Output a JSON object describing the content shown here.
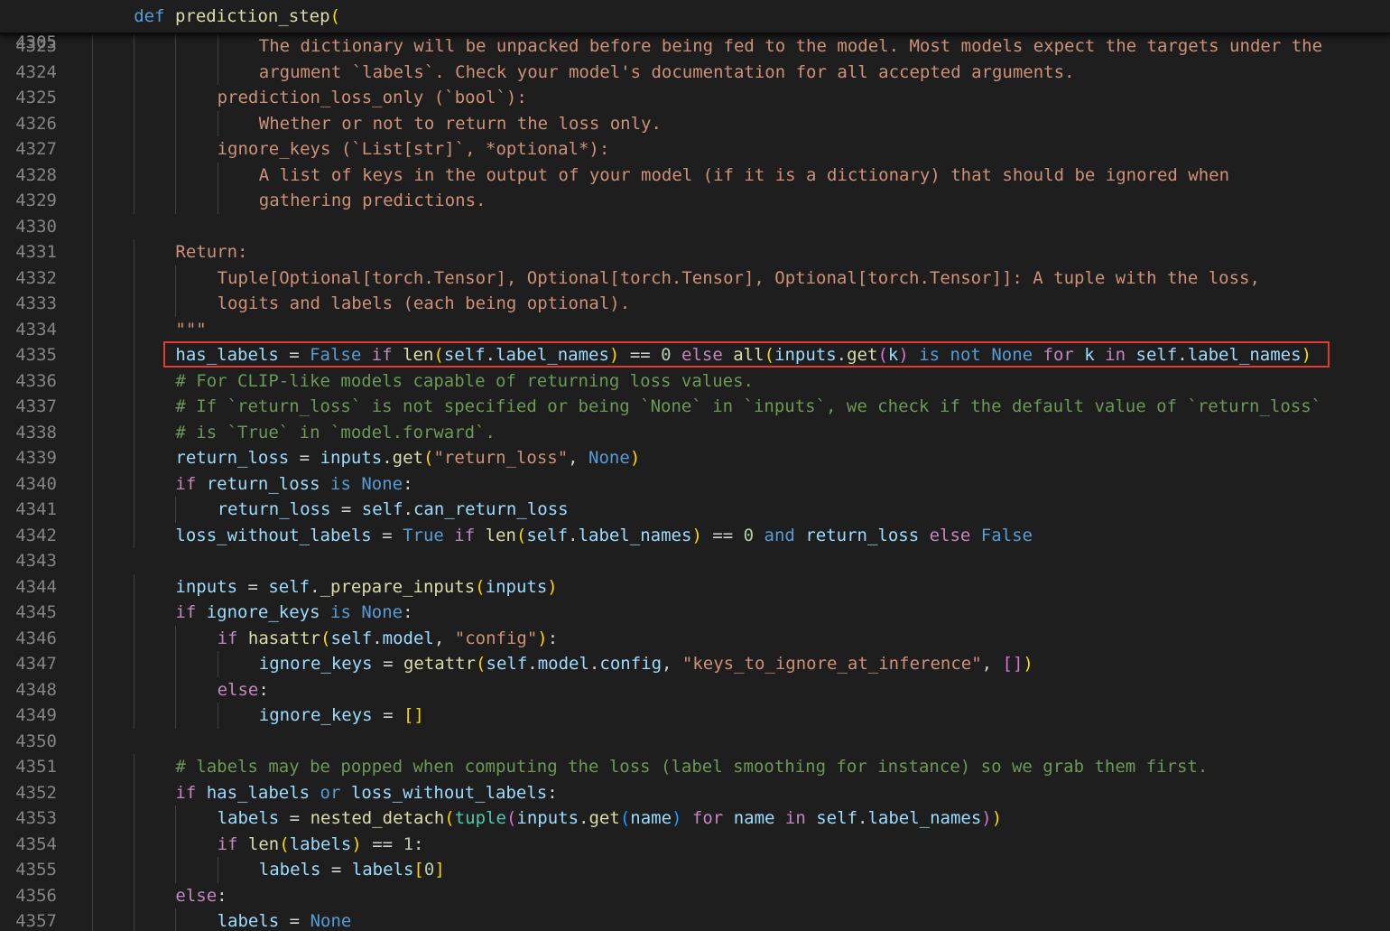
{
  "sticky": {
    "line_number": "4305",
    "tokens": [
      [
        "k",
        "def "
      ],
      [
        "f",
        "prediction_step"
      ],
      [
        "b1",
        "("
      ]
    ]
  },
  "lines": [
    {
      "n": "4323",
      "indent": 4,
      "tokens": [
        [
          "s",
          "The dictionary will be unpacked before being fed to the model. Most models expect the targets under the"
        ]
      ]
    },
    {
      "n": "4324",
      "indent": 4,
      "tokens": [
        [
          "s",
          "argument `labels`. Check your model's documentation for all accepted arguments."
        ]
      ]
    },
    {
      "n": "4325",
      "indent": 3,
      "tokens": [
        [
          "s",
          "prediction_loss_only (`bool`):"
        ]
      ]
    },
    {
      "n": "4326",
      "indent": 4,
      "tokens": [
        [
          "s",
          "Whether or not to return the loss only."
        ]
      ]
    },
    {
      "n": "4327",
      "indent": 3,
      "tokens": [
        [
          "s",
          "ignore_keys (`List[str]`, *optional*):"
        ]
      ]
    },
    {
      "n": "4328",
      "indent": 4,
      "tokens": [
        [
          "s",
          "A list of keys in the output of your model (if it is a dictionary) that should be ignored when"
        ]
      ]
    },
    {
      "n": "4329",
      "indent": 4,
      "tokens": [
        [
          "s",
          "gathering predictions."
        ]
      ]
    },
    {
      "n": "4330",
      "indent": 1,
      "tokens": []
    },
    {
      "n": "4331",
      "indent": 2,
      "tokens": [
        [
          "s",
          "Return:"
        ]
      ]
    },
    {
      "n": "4332",
      "indent": 3,
      "tokens": [
        [
          "s",
          "Tuple[Optional[torch.Tensor], Optional[torch.Tensor], Optional[torch.Tensor]]: A tuple with the loss,"
        ]
      ]
    },
    {
      "n": "4333",
      "indent": 3,
      "tokens": [
        [
          "s",
          "logits and labels (each being optional)."
        ]
      ]
    },
    {
      "n": "4334",
      "indent": 2,
      "tokens": [
        [
          "s",
          "\"\"\""
        ]
      ]
    },
    {
      "n": "4335",
      "indent": 2,
      "highlight": true,
      "tokens": [
        [
          "v",
          "has_labels"
        ],
        [
          "w",
          " = "
        ],
        [
          "k",
          "False"
        ],
        [
          "c",
          " if "
        ],
        [
          "f",
          "len"
        ],
        [
          "b1",
          "("
        ],
        [
          "v",
          "self"
        ],
        [
          "w",
          "."
        ],
        [
          "v",
          "label_names"
        ],
        [
          "b1",
          ")"
        ],
        [
          "w",
          " == "
        ],
        [
          "n",
          "0"
        ],
        [
          "c",
          " else "
        ],
        [
          "f",
          "all"
        ],
        [
          "b1",
          "("
        ],
        [
          "v",
          "inputs"
        ],
        [
          "w",
          "."
        ],
        [
          "f",
          "get"
        ],
        [
          "b2",
          "("
        ],
        [
          "v",
          "k"
        ],
        [
          "b2",
          ")"
        ],
        [
          "k",
          " is not "
        ],
        [
          "k",
          "None"
        ],
        [
          "c",
          " for "
        ],
        [
          "v",
          "k"
        ],
        [
          "c",
          " in "
        ],
        [
          "v",
          "self"
        ],
        [
          "w",
          "."
        ],
        [
          "v",
          "label_names"
        ],
        [
          "b1",
          ")"
        ]
      ]
    },
    {
      "n": "4336",
      "indent": 2,
      "tokens": [
        [
          "m",
          "# For CLIP-like models capable of returning loss values."
        ]
      ]
    },
    {
      "n": "4337",
      "indent": 2,
      "tokens": [
        [
          "m",
          "# If `return_loss` is not specified or being `None` in `inputs`, we check if the default value of `return_loss`"
        ]
      ]
    },
    {
      "n": "4338",
      "indent": 2,
      "tokens": [
        [
          "m",
          "# is `True` in `model.forward`."
        ]
      ]
    },
    {
      "n": "4339",
      "indent": 2,
      "tokens": [
        [
          "v",
          "return_loss"
        ],
        [
          "w",
          " = "
        ],
        [
          "v",
          "inputs"
        ],
        [
          "w",
          "."
        ],
        [
          "f",
          "get"
        ],
        [
          "b1",
          "("
        ],
        [
          "s",
          "\"return_loss\""
        ],
        [
          "w",
          ", "
        ],
        [
          "k",
          "None"
        ],
        [
          "b1",
          ")"
        ]
      ]
    },
    {
      "n": "4340",
      "indent": 2,
      "tokens": [
        [
          "c",
          "if "
        ],
        [
          "v",
          "return_loss"
        ],
        [
          "k",
          " is "
        ],
        [
          "k",
          "None"
        ],
        [
          "w",
          ":"
        ]
      ]
    },
    {
      "n": "4341",
      "indent": 3,
      "tokens": [
        [
          "v",
          "return_loss"
        ],
        [
          "w",
          " = "
        ],
        [
          "v",
          "self"
        ],
        [
          "w",
          "."
        ],
        [
          "v",
          "can_return_loss"
        ]
      ]
    },
    {
      "n": "4342",
      "indent": 2,
      "tokens": [
        [
          "v",
          "loss_without_labels"
        ],
        [
          "w",
          " = "
        ],
        [
          "k",
          "True"
        ],
        [
          "c",
          " if "
        ],
        [
          "f",
          "len"
        ],
        [
          "b1",
          "("
        ],
        [
          "v",
          "self"
        ],
        [
          "w",
          "."
        ],
        [
          "v",
          "label_names"
        ],
        [
          "b1",
          ")"
        ],
        [
          "w",
          " == "
        ],
        [
          "n",
          "0"
        ],
        [
          "k",
          " and "
        ],
        [
          "v",
          "return_loss"
        ],
        [
          "c",
          " else "
        ],
        [
          "k",
          "False"
        ]
      ]
    },
    {
      "n": "4343",
      "indent": 1,
      "tokens": []
    },
    {
      "n": "4344",
      "indent": 2,
      "tokens": [
        [
          "v",
          "inputs"
        ],
        [
          "w",
          " = "
        ],
        [
          "v",
          "self"
        ],
        [
          "w",
          "."
        ],
        [
          "f",
          "_prepare_inputs"
        ],
        [
          "b1",
          "("
        ],
        [
          "v",
          "inputs"
        ],
        [
          "b1",
          ")"
        ]
      ]
    },
    {
      "n": "4345",
      "indent": 2,
      "tokens": [
        [
          "c",
          "if "
        ],
        [
          "v",
          "ignore_keys"
        ],
        [
          "k",
          " is "
        ],
        [
          "k",
          "None"
        ],
        [
          "w",
          ":"
        ]
      ]
    },
    {
      "n": "4346",
      "indent": 3,
      "tokens": [
        [
          "c",
          "if "
        ],
        [
          "f",
          "hasattr"
        ],
        [
          "b1",
          "("
        ],
        [
          "v",
          "self"
        ],
        [
          "w",
          "."
        ],
        [
          "v",
          "model"
        ],
        [
          "w",
          ", "
        ],
        [
          "s",
          "\"config\""
        ],
        [
          "b1",
          ")"
        ],
        [
          "w",
          ":"
        ]
      ]
    },
    {
      "n": "4347",
      "indent": 4,
      "tokens": [
        [
          "v",
          "ignore_keys"
        ],
        [
          "w",
          " = "
        ],
        [
          "f",
          "getattr"
        ],
        [
          "b1",
          "("
        ],
        [
          "v",
          "self"
        ],
        [
          "w",
          "."
        ],
        [
          "v",
          "model"
        ],
        [
          "w",
          "."
        ],
        [
          "v",
          "config"
        ],
        [
          "w",
          ", "
        ],
        [
          "s",
          "\"keys_to_ignore_at_inference\""
        ],
        [
          "w",
          ", "
        ],
        [
          "b2",
          "[]"
        ],
        [
          "b1",
          ")"
        ]
      ]
    },
    {
      "n": "4348",
      "indent": 3,
      "tokens": [
        [
          "c",
          "else"
        ],
        [
          "w",
          ":"
        ]
      ]
    },
    {
      "n": "4349",
      "indent": 4,
      "tokens": [
        [
          "v",
          "ignore_keys"
        ],
        [
          "w",
          " = "
        ],
        [
          "b1",
          "[]"
        ]
      ]
    },
    {
      "n": "4350",
      "indent": 1,
      "tokens": []
    },
    {
      "n": "4351",
      "indent": 2,
      "tokens": [
        [
          "m",
          "# labels may be popped when computing the loss (label smoothing for instance) so we grab them first."
        ]
      ]
    },
    {
      "n": "4352",
      "indent": 2,
      "tokens": [
        [
          "c",
          "if "
        ],
        [
          "v",
          "has_labels"
        ],
        [
          "k",
          " or "
        ],
        [
          "v",
          "loss_without_labels"
        ],
        [
          "w",
          ":"
        ]
      ]
    },
    {
      "n": "4353",
      "indent": 3,
      "tokens": [
        [
          "v",
          "labels"
        ],
        [
          "w",
          " = "
        ],
        [
          "f",
          "nested_detach"
        ],
        [
          "b1",
          "("
        ],
        [
          "t",
          "tuple"
        ],
        [
          "b2",
          "("
        ],
        [
          "v",
          "inputs"
        ],
        [
          "w",
          "."
        ],
        [
          "f",
          "get"
        ],
        [
          "b3",
          "("
        ],
        [
          "v",
          "name"
        ],
        [
          "b3",
          ")"
        ],
        [
          "c",
          " for "
        ],
        [
          "v",
          "name"
        ],
        [
          "c",
          " in "
        ],
        [
          "v",
          "self"
        ],
        [
          "w",
          "."
        ],
        [
          "v",
          "label_names"
        ],
        [
          "b2",
          ")"
        ],
        [
          "b1",
          ")"
        ]
      ]
    },
    {
      "n": "4354",
      "indent": 3,
      "tokens": [
        [
          "c",
          "if "
        ],
        [
          "f",
          "len"
        ],
        [
          "b1",
          "("
        ],
        [
          "v",
          "labels"
        ],
        [
          "b1",
          ")"
        ],
        [
          "w",
          " == "
        ],
        [
          "n",
          "1"
        ],
        [
          "w",
          ":"
        ]
      ]
    },
    {
      "n": "4355",
      "indent": 4,
      "tokens": [
        [
          "v",
          "labels"
        ],
        [
          "w",
          " = "
        ],
        [
          "v",
          "labels"
        ],
        [
          "b1",
          "["
        ],
        [
          "n",
          "0"
        ],
        [
          "b1",
          "]"
        ]
      ]
    },
    {
      "n": "4356",
      "indent": 2,
      "tokens": [
        [
          "c",
          "else"
        ],
        [
          "w",
          ":"
        ]
      ]
    },
    {
      "n": "4357",
      "indent": 3,
      "tokens": [
        [
          "v",
          "labels"
        ],
        [
          "w",
          " = "
        ],
        [
          "k",
          "None"
        ]
      ]
    }
  ]
}
